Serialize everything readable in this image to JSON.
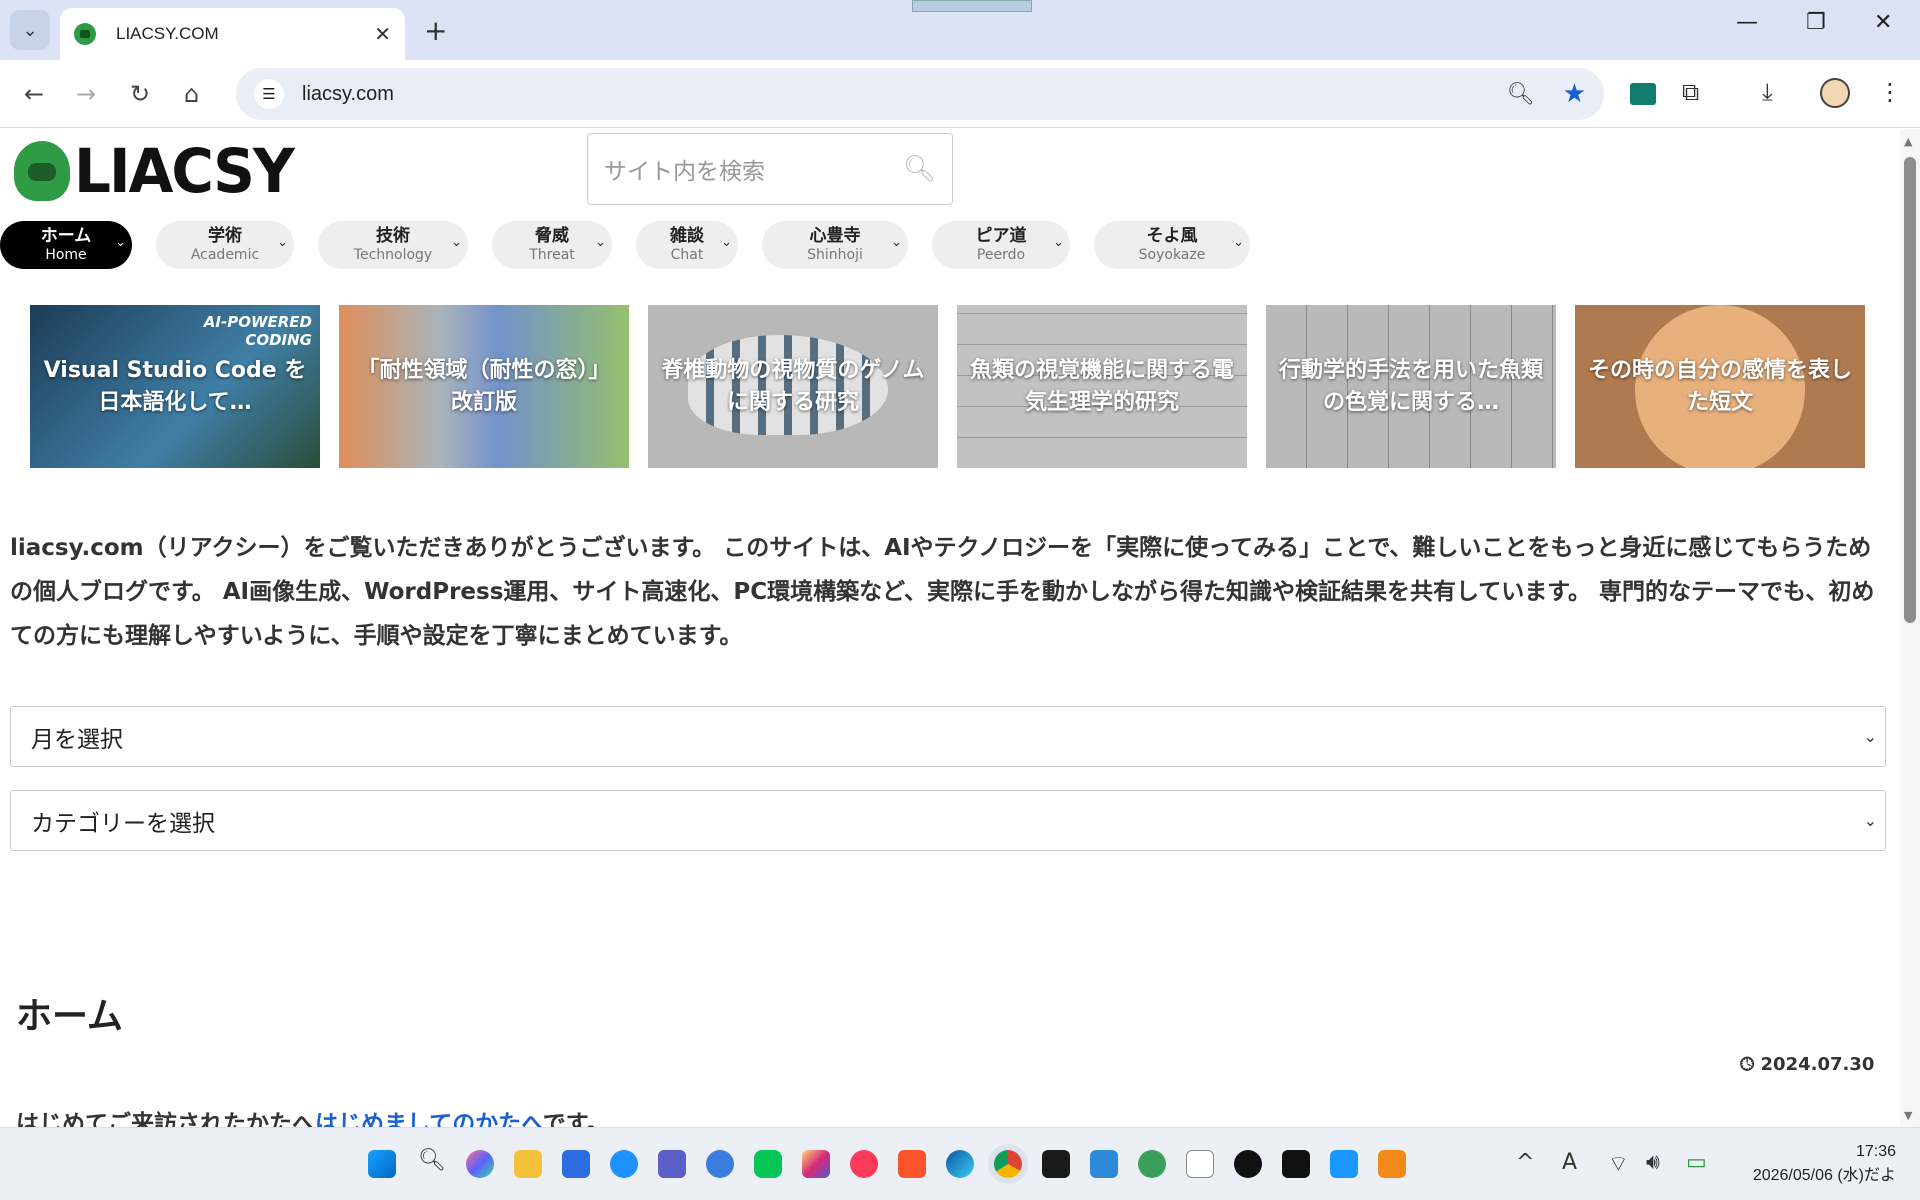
{
  "browser": {
    "tab_title": "LIACSY.COM",
    "url": "liacsy.com"
  },
  "site": {
    "logo_text": "LIACSY",
    "search_placeholder": "サイト内を検索",
    "menu": [
      {
        "jp": "ホーム",
        "en": "Home",
        "active": true
      },
      {
        "jp": "学術",
        "en": "Academic"
      },
      {
        "jp": "技術",
        "en": "Technology"
      },
      {
        "jp": "脅威",
        "en": "Threat"
      },
      {
        "jp": "雑談",
        "en": "Chat"
      },
      {
        "jp": "心豊寺",
        "en": "Shinhoji"
      },
      {
        "jp": "ピア道",
        "en": "Peerdo"
      },
      {
        "jp": "そよ風",
        "en": "Soyokaze"
      }
    ],
    "cards": [
      {
        "title": "Visual Studio Code を日本語化して…",
        "badge": "AI-POWERED CODING"
      },
      {
        "title": "「耐性領域（耐性の窓）」改訂版"
      },
      {
        "title": "脊椎動物の視物質のゲノムに関する研究"
      },
      {
        "title": "魚類の視覚機能に関する電気生理学的研究"
      },
      {
        "title": "行動学的手法を用いた魚類の色覚に関する…"
      },
      {
        "title": "その時の自分の感情を表した短文"
      }
    ],
    "intro": "liacsy.com（リアクシー）をご覧いただきありがとうございます。 このサイトは、AIやテクノロジーを「実際に使ってみる」ことで、難しいことをもっと身近に感じてもらうための個人ブログです。 AI画像生成、WordPress運用、サイト高速化、PC環境構築など、実際に手を動かしながら得た知識や検証結果を共有しています。 専門的なテーマでも、初めての方にも理解しやすいように、手順や設定を丁寧にまとめています。",
    "month_select": "月を選択",
    "category_select": "カテゴリーを選択",
    "heading": "ホーム",
    "date": "2024.07.30",
    "welcome_prefix": "はじめてご来訪されたかたへ",
    "welcome_link": "はじめましてのかたへ",
    "welcome_suffix": "です。"
  },
  "taskbar": {
    "time": "17:36",
    "date": "2026/05/06 (水)だよ"
  }
}
